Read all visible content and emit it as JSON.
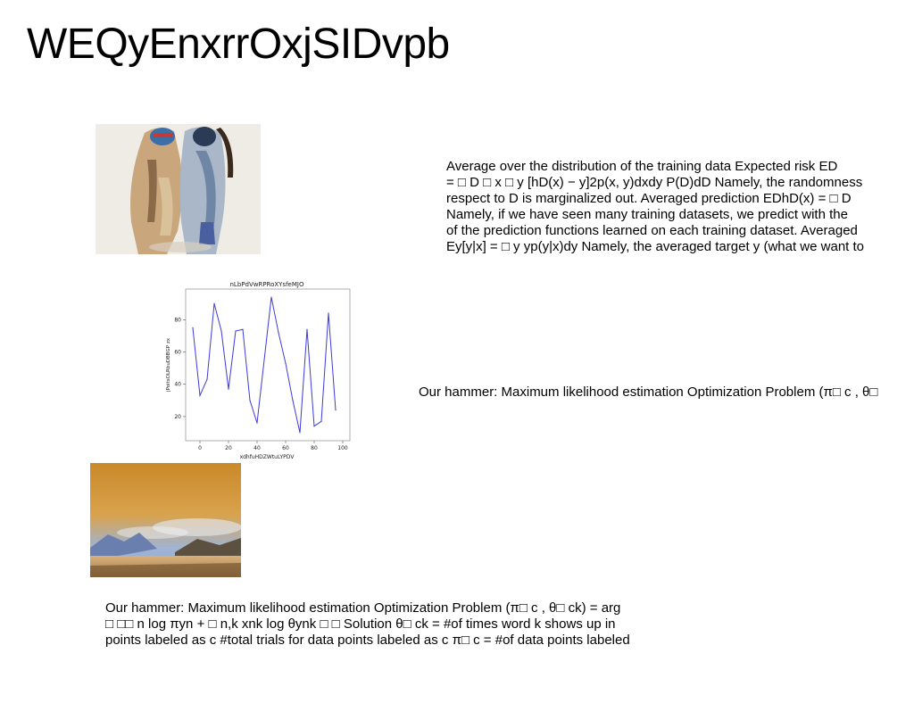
{
  "slide": {
    "title": "WEQyEnxrrOxjSIDvpb"
  },
  "blocks": {
    "text1": {
      "lines": [
        "Average over the distribution of the training data Expected risk ED",
        "= □ D □ x □ y [hD(x) − y]2p(x, y)dxdy P(D)dD Namely, the randomness",
        "respect to D is marginalized out. Averaged prediction EDhD(x) = □ D",
        "Namely, if we have seen many training datasets, we predict with the",
        "of the prediction functions learned on each training dataset. Averaged",
        "Ey[y|x] = □ y yp(y|x)dy Namely, the averaged target y (what we want to"
      ]
    },
    "text2": {
      "lines": [
        "Our hammer: Maximum likelihood estimation Optimization Problem (π□ c , θ□"
      ]
    },
    "text3": {
      "lines": [
        "Our hammer: Maximum likelihood estimation Optimization Problem (π□ c , θ□ ck) = arg",
        "□ □□ n log πyn + □ n,k xnk log θynk □ □ Solution θ□ ck = #of times word k shows up in",
        "points labeled as c #total trials for data points labeled as c π□ c = #of data points labeled"
      ]
    }
  },
  "images": {
    "photo1": "fashion-photo-two-people",
    "photo2": "landscape-photo-lake-mountains-sunset"
  },
  "chart_data": {
    "type": "line",
    "title": "nLbPdVwRPRoXYsfeMJO",
    "xlabel": "xdhfuHDZWtuLYPDV",
    "ylabel": "jPoitsOLRbuDBBGP zx",
    "x": [
      -5,
      0,
      5,
      10,
      15,
      20,
      25,
      30,
      35,
      40,
      50,
      55,
      60,
      65,
      70,
      75,
      80,
      85,
      90,
      95,
      100
    ],
    "series": [
      {
        "values": [
          75,
          33,
          43,
          90,
          73,
          37,
          73,
          74,
          30,
          16,
          94,
          72,
          53,
          30,
          10,
          74,
          14,
          17,
          84,
          24
        ]
      }
    ],
    "xlim": [
      -10,
      105
    ],
    "ylim": [
      5,
      99
    ],
    "xticks": [
      0,
      20,
      40,
      60,
      80,
      100
    ],
    "yticks": [
      20,
      40,
      60,
      80
    ],
    "line_color": "#3b3bd9",
    "grid": false
  }
}
